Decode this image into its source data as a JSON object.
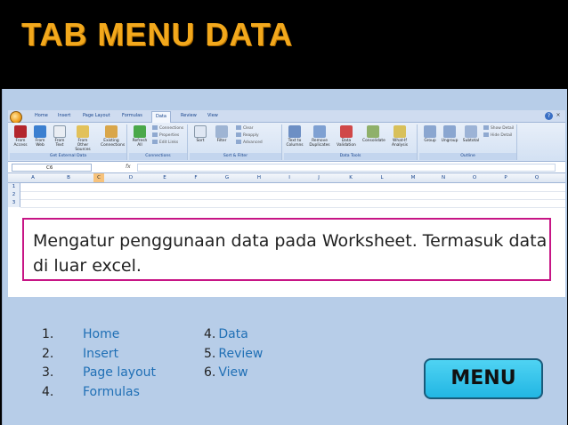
{
  "page_title": "TAB MENU DATA",
  "excel": {
    "tabs": [
      "Home",
      "Insert",
      "Page Layout",
      "Formulas",
      "Data",
      "Review",
      "View"
    ],
    "active_tab": "Data",
    "groups": [
      {
        "label": "Get External Data",
        "buttons": [
          "From\nAccess",
          "From\nWeb",
          "From\nText",
          "From Other\nSources",
          "Existing\nConnections"
        ]
      },
      {
        "label": "Connections",
        "buttons": [
          "Refresh\nAll"
        ],
        "small": [
          "Connections",
          "Properties",
          "Edit Links"
        ]
      },
      {
        "label": "Sort & Filter",
        "buttons": [
          "Sort",
          "Filter"
        ],
        "small": [
          "Clear",
          "Reapply",
          "Advanced"
        ]
      },
      {
        "label": "Data Tools",
        "buttons": [
          "Text to\nColumns",
          "Remove\nDuplicates",
          "Data\nValidation",
          "Consolidate",
          "What-If\nAnalysis"
        ]
      },
      {
        "label": "Outline",
        "buttons": [
          "Group",
          "Ungroup",
          "Subtotal"
        ],
        "small": [
          "Show Detail",
          "Hide Detail"
        ]
      }
    ],
    "name_box": "C6",
    "fx": "fx",
    "columns": [
      "A",
      "B",
      "C",
      "D",
      "E",
      "F",
      "G",
      "H",
      "I",
      "J",
      "K",
      "L",
      "M",
      "N",
      "O",
      "P",
      "Q"
    ],
    "selected_column": "C",
    "rows": [
      "1",
      "2",
      "3"
    ]
  },
  "description": "Mengatur penggunaan data pada Worksheet. Termasuk data di luar excel.",
  "menu_list_left": [
    {
      "num": "1.",
      "label": "Home"
    },
    {
      "num": "2.",
      "label": "Insert"
    },
    {
      "num": "3.",
      "label": "Page layout"
    },
    {
      "num": "4.",
      "label": "Formulas"
    }
  ],
  "menu_list_right": [
    {
      "num": "4.",
      "label": "Data"
    },
    {
      "num": "5.",
      "label": "Review"
    },
    {
      "num": "6.",
      "label": "View"
    }
  ],
  "menu_button": "MENU",
  "colors": {
    "title": "#f2a81c",
    "panel": "#b7cde8",
    "link": "#1f6fb5",
    "textbox_border": "#c71585",
    "menu_button": "#22b6e3"
  }
}
